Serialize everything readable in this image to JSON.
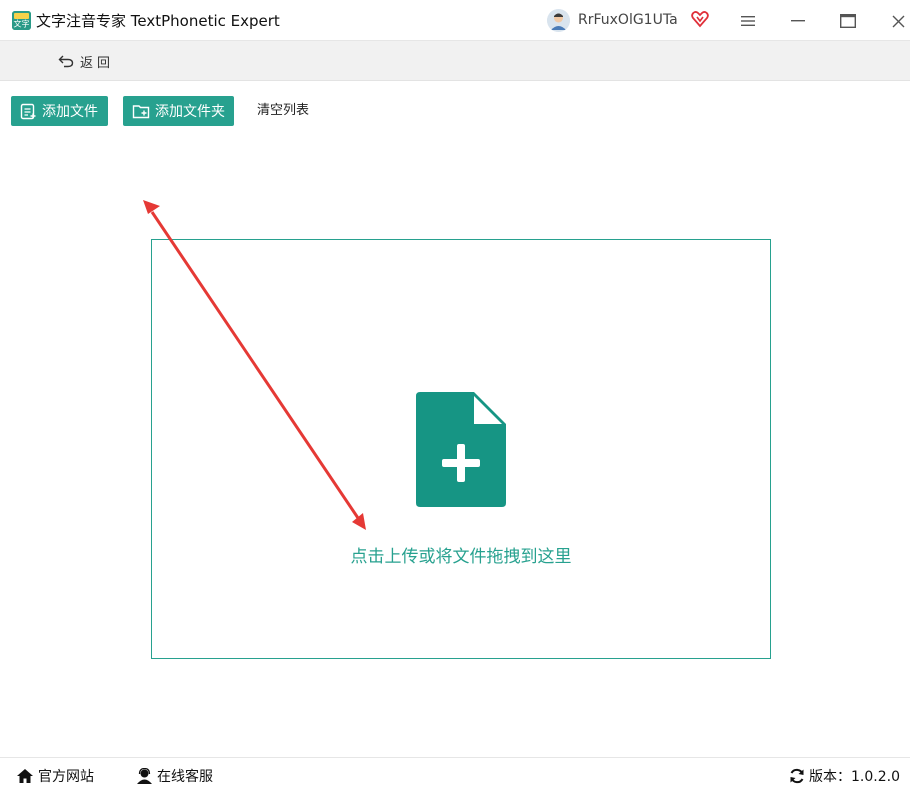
{
  "app": {
    "title": "文字注音专家 TextPhonetic Expert",
    "logo_icon": "app-logo-icon",
    "logo_text": "文字"
  },
  "user": {
    "name": "RrFuxOlG1UTa",
    "vip_icon": "vip-heart-icon"
  },
  "window_controls": [
    "menu-icon",
    "minimize-icon",
    "maximize-icon",
    "close-icon"
  ],
  "nav": {
    "back_label": "返回"
  },
  "toolbar": {
    "add_file_label": "添加文件",
    "add_folder_label": "添加文件夹",
    "clear_label": "清空列表"
  },
  "dropzone": {
    "hint": "点击上传或将文件拖拽到这里",
    "icon": "file-plus-icon"
  },
  "footer": {
    "website_label": "官方网站",
    "support_label": "在线客服",
    "version_label": "版本：1.0.2.0"
  },
  "colors": {
    "accent": "#27a18f",
    "annotation_arrow": "#e53935",
    "navbar_bg": "#f1f1f1"
  }
}
